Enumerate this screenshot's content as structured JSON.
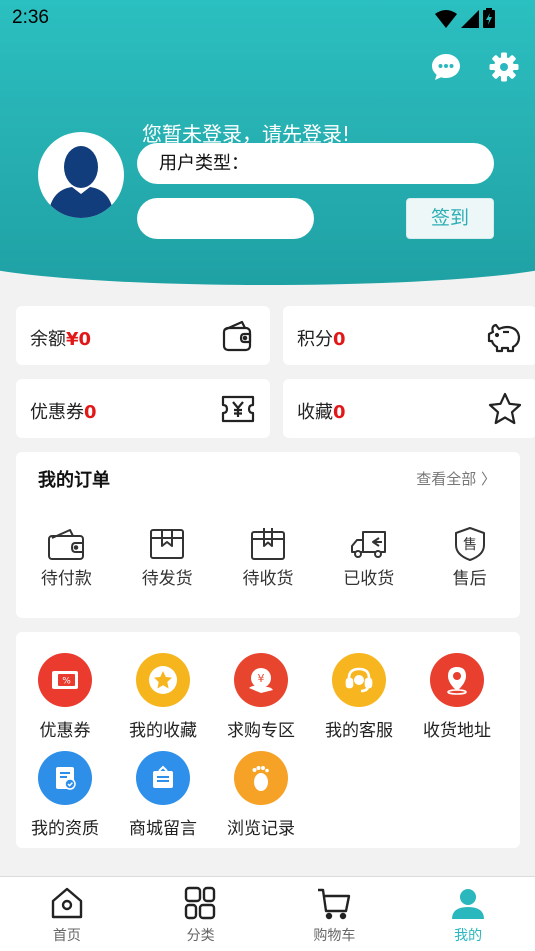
{
  "status_bar": {
    "time": "2:36"
  },
  "colors": {
    "teal": "#2ab7bd",
    "value_red": "#e21818"
  },
  "header": {
    "icons": [
      "message-icon",
      "settings-icon"
    ],
    "login_tip": "您暂未登录，请先登录!",
    "user_type_label": "用户类型：",
    "checkin_label": "签到"
  },
  "assets": [
    {
      "label": "余额",
      "value": "¥0",
      "icon": "wallet-icon"
    },
    {
      "label": "积分",
      "value": "0",
      "icon": "piggy-bank-icon"
    },
    {
      "label": "优惠券",
      "value": "0",
      "icon": "coupon-icon"
    },
    {
      "label": "收藏",
      "value": "0",
      "icon": "star-icon"
    }
  ],
  "orders": {
    "title": "我的订单",
    "view_all": "查看全部 〉",
    "items": [
      {
        "label": "待付款",
        "icon": "wallet-icon"
      },
      {
        "label": "待发货",
        "icon": "box-icon"
      },
      {
        "label": "待收货",
        "icon": "package-icon"
      },
      {
        "label": "已收货",
        "icon": "truck-icon"
      },
      {
        "label": "售后",
        "icon": "after-sale-icon"
      }
    ]
  },
  "services": [
    {
      "label": "优惠券",
      "icon": "coupon-icon",
      "color": "#ea3b2e"
    },
    {
      "label": "我的收藏",
      "icon": "star-icon",
      "color": "#f6b51d"
    },
    {
      "label": "求购专区",
      "icon": "purchase-icon",
      "color": "#e8452f"
    },
    {
      "label": "我的客服",
      "icon": "headset-icon",
      "color": "#f7b61f"
    },
    {
      "label": "收货地址",
      "icon": "location-icon",
      "color": "#e83f2f"
    },
    {
      "label": "我的资质",
      "icon": "certificate-icon",
      "color": "#2d8fe8"
    },
    {
      "label": "商城留言",
      "icon": "message-board-icon",
      "color": "#2e90ea"
    },
    {
      "label": "浏览记录",
      "icon": "footprint-icon",
      "color": "#f5a227"
    }
  ],
  "tabbar": [
    {
      "label": "首页",
      "icon": "home-icon"
    },
    {
      "label": "分类",
      "icon": "category-icon"
    },
    {
      "label": "购物车",
      "icon": "cart-icon"
    },
    {
      "label": "我的",
      "icon": "profile-icon",
      "active": true
    }
  ]
}
